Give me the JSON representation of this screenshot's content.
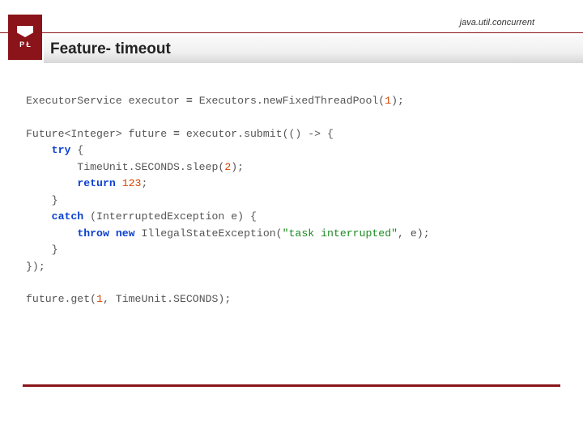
{
  "header": {
    "package": "java.util.concurrent",
    "title": "Feature- timeout",
    "logo_letters": "P Ł"
  },
  "code": {
    "l1a": "ExecutorService executor ",
    "l1b": " Executors.newFixedThreadPool(",
    "l1c": ");",
    "l2a": "Future<Integer> future ",
    "l2b": " executor.submit(() -> {",
    "l3a": "    ",
    "l3b": " {",
    "l4a": "        TimeUnit.SECONDS.sleep(",
    "l4b": ");",
    "l5a": "        ",
    "l5b": " ",
    "l5c": ";",
    "l6": "    }",
    "l7a": "    ",
    "l7b": " (InterruptedException e) {",
    "l8a": "        ",
    "l8b": " IllegalStateException(",
    "l8c": ", e);",
    "l9": "    }",
    "l10": "});",
    "l11a": "future.get(",
    "l11b": ", TimeUnit.SECONDS);",
    "kw_try": "try",
    "kw_return": "return",
    "kw_catch": "catch",
    "kw_throw": "throw",
    "kw_new": "new",
    "num_1a": "1",
    "num_2": "2",
    "num_123": "123",
    "num_1b": "1",
    "str_task": "\"task interrupted\"",
    "op_eq1": "=",
    "op_eq2": "="
  }
}
